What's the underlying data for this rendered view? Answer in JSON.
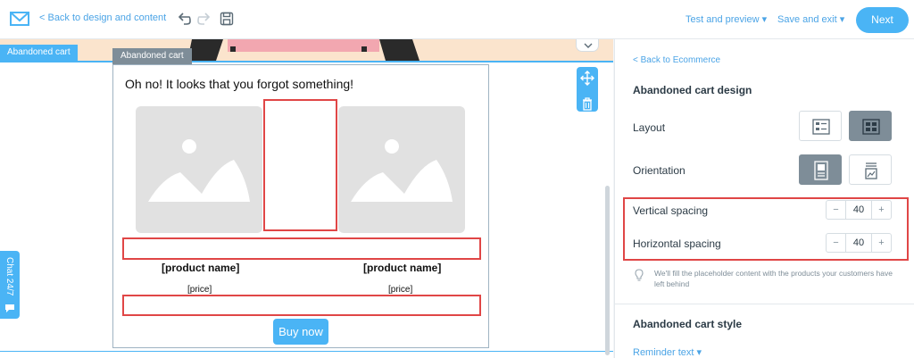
{
  "topbar": {
    "back_label": "< Back to design and content",
    "test_preview_label": "Test and preview ▾",
    "save_exit_label": "Save and exit ▾",
    "next_label": "Next"
  },
  "canvas": {
    "block_tab_label": "Abandoned cart",
    "inner_tab_label": "Abandoned cart",
    "greeting": "Oh no! It looks that you forgot something!",
    "products": [
      {
        "name": "[product name]",
        "price": "[price]"
      },
      {
        "name": "[product name]",
        "price": "[price]"
      }
    ],
    "buy_label": "Buy now",
    "chat_label": "Chat 24/7"
  },
  "panel": {
    "back_label": "< Back to Ecommerce",
    "design_title": "Abandoned cart design",
    "layout_label": "Layout",
    "orientation_label": "Orientation",
    "vertical_spacing_label": "Vertical spacing",
    "vertical_spacing_value": "40",
    "horizontal_spacing_label": "Horizontal spacing",
    "horizontal_spacing_value": "40",
    "stepper_minus": "−",
    "stepper_plus": "+",
    "hint": "We'll fill the placeholder content with the products your customers have left behind",
    "style_title": "Abandoned cart style",
    "reminder_label": "Reminder text ▾"
  },
  "colors": {
    "accent": "#4ab4f5",
    "highlight": "#e04646",
    "active_option": "#7e8d98"
  }
}
